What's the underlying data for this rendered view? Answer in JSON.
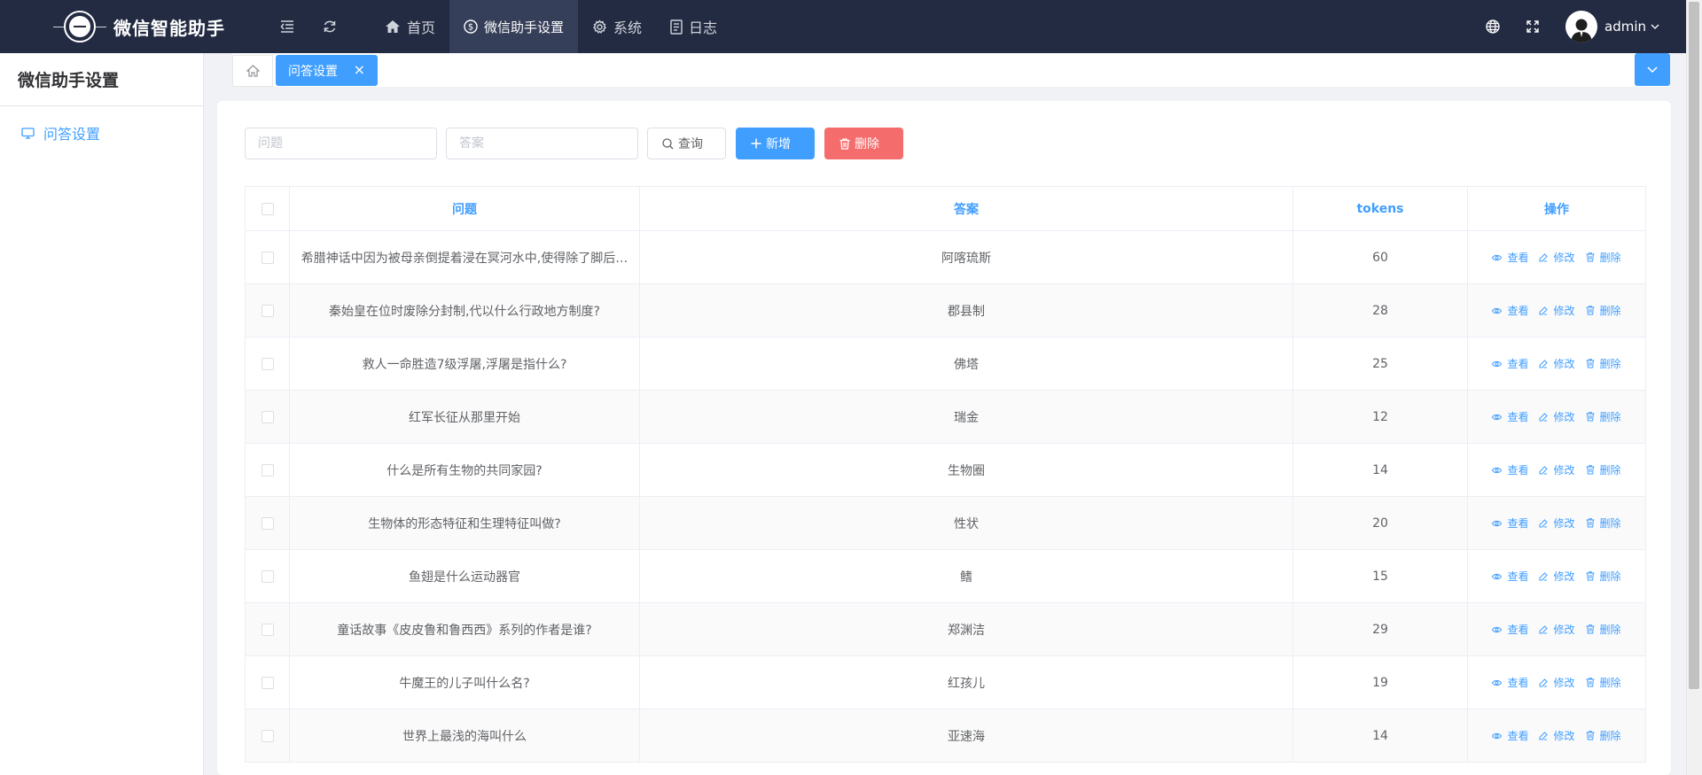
{
  "app": {
    "title": "微信智能助手"
  },
  "nav": [
    {
      "label": "首页",
      "icon": "home-icon"
    },
    {
      "label": "微信助手设置",
      "icon": "dollar-circle-icon",
      "active": true
    },
    {
      "label": "系统",
      "icon": "gear-icon"
    },
    {
      "label": "日志",
      "icon": "document-icon"
    }
  ],
  "user": {
    "name": "admin"
  },
  "sidebar": {
    "title": "微信助手设置",
    "items": [
      {
        "label": "问答设置",
        "icon": "monitor-icon",
        "active": true
      }
    ]
  },
  "tabs": [
    {
      "label": "问答设置",
      "active": true
    }
  ],
  "filters": {
    "question_placeholder": "问题",
    "answer_placeholder": "答案",
    "search_label": "查询",
    "add_label": "新增",
    "delete_label": "删除"
  },
  "table": {
    "headers": {
      "question": "问题",
      "answer": "答案",
      "tokens": "tokens",
      "actions": "操作"
    },
    "actions": {
      "view": "查看",
      "edit": "修改",
      "delete": "删除"
    },
    "rows": [
      {
        "question": "希腊神话中因为被母亲倒提着浸在冥河水中,使得除了脚后…",
        "answer": "阿喀琉斯",
        "tokens": "60"
      },
      {
        "question": "秦始皇在位时废除分封制,代以什么行政地方制度?",
        "answer": "郡县制",
        "tokens": "28"
      },
      {
        "question": "救人一命胜造7级浮屠,浮屠是指什么?",
        "answer": "佛塔",
        "tokens": "25"
      },
      {
        "question": "红军长征从那里开始",
        "answer": "瑞金",
        "tokens": "12"
      },
      {
        "question": "什么是所有生物的共同家园?",
        "answer": "生物圈",
        "tokens": "14"
      },
      {
        "question": "生物体的形态特征和生理特征叫做?",
        "answer": "性状",
        "tokens": "20"
      },
      {
        "question": "鱼翅是什么运动器官",
        "answer": "鳍",
        "tokens": "15"
      },
      {
        "question": "童话故事《皮皮鲁和鲁西西》系列的作者是谁?",
        "answer": "郑渊洁",
        "tokens": "29"
      },
      {
        "question": "牛魔王的儿子叫什么名?",
        "answer": "红孩儿",
        "tokens": "19"
      },
      {
        "question": "世界上最浅的海叫什么",
        "answer": "亚速海",
        "tokens": "14"
      }
    ]
  },
  "colors": {
    "topbar": "#232b42",
    "primary": "#409eff",
    "danger": "#f56c6c"
  }
}
